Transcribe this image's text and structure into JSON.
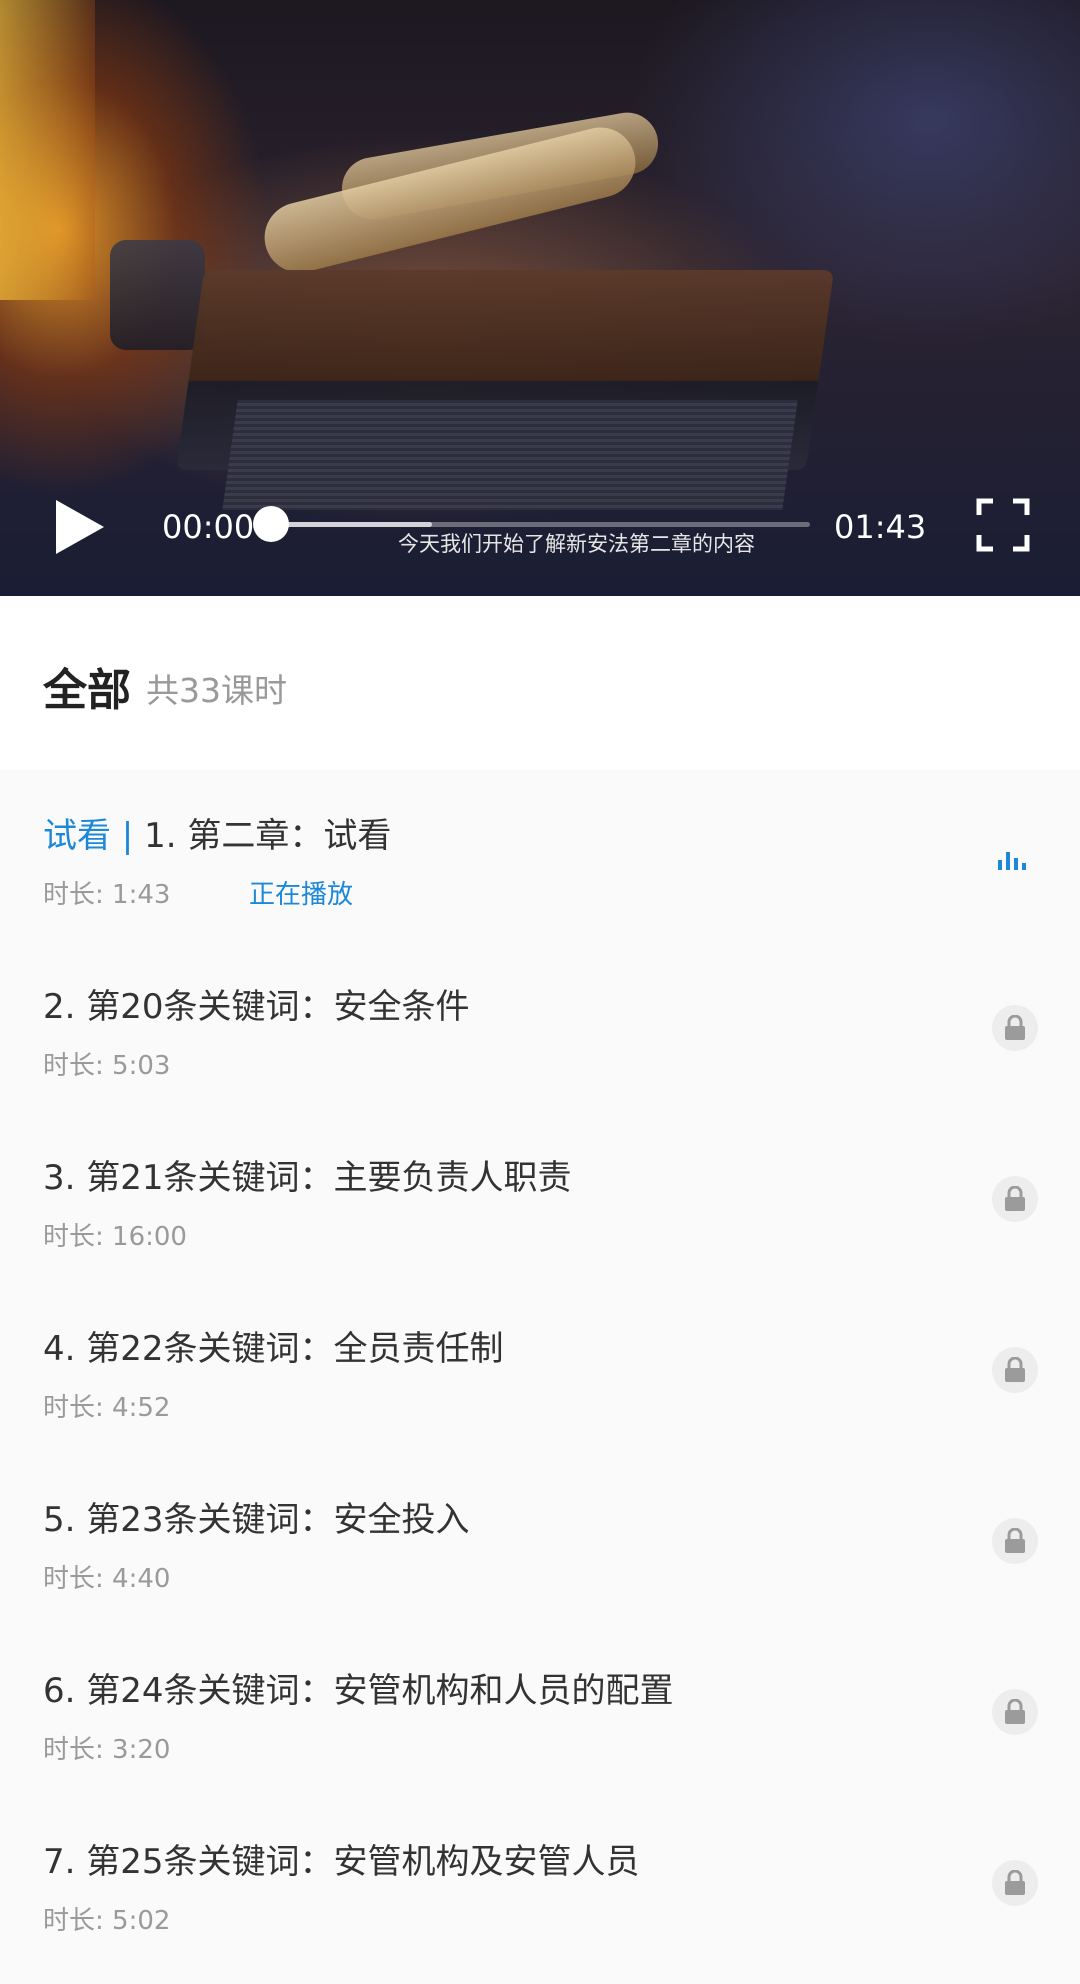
{
  "player": {
    "current_time": "00:00",
    "total_time": "01:43",
    "progress": 0,
    "buffered": 0.3,
    "subtitle": "今天我们开始了解新安法第二章的内容"
  },
  "header": {
    "title": "全部",
    "count": "共33课时"
  },
  "lessons": [
    {
      "trial_tag": "试看 | ",
      "title": "1. 第二章：试看",
      "duration": "时长: 1:43",
      "status": "正在播放",
      "icon": "playing-bars-icon"
    },
    {
      "title": "2. 第20条关键词：安全条件",
      "duration": "时长: 5:03",
      "icon": "lock-icon"
    },
    {
      "title": "3. 第21条关键词：主要负责人职责",
      "duration": "时长: 16:00",
      "icon": "lock-icon"
    },
    {
      "title": "4. 第22条关键词：全员责任制",
      "duration": "时长: 4:52",
      "icon": "lock-icon"
    },
    {
      "title": "5. 第23条关键词：安全投入",
      "duration": "时长: 4:40",
      "icon": "lock-icon"
    },
    {
      "title": "6. 第24条关键词：安管机构和人员的配置",
      "duration": "时长: 3:20",
      "icon": "lock-icon"
    },
    {
      "title": "7. 第25条关键词：安管机构及安管人员",
      "duration": "时长: 5:02",
      "icon": "lock-icon"
    }
  ],
  "colors": {
    "accent": "#1e88d8"
  }
}
